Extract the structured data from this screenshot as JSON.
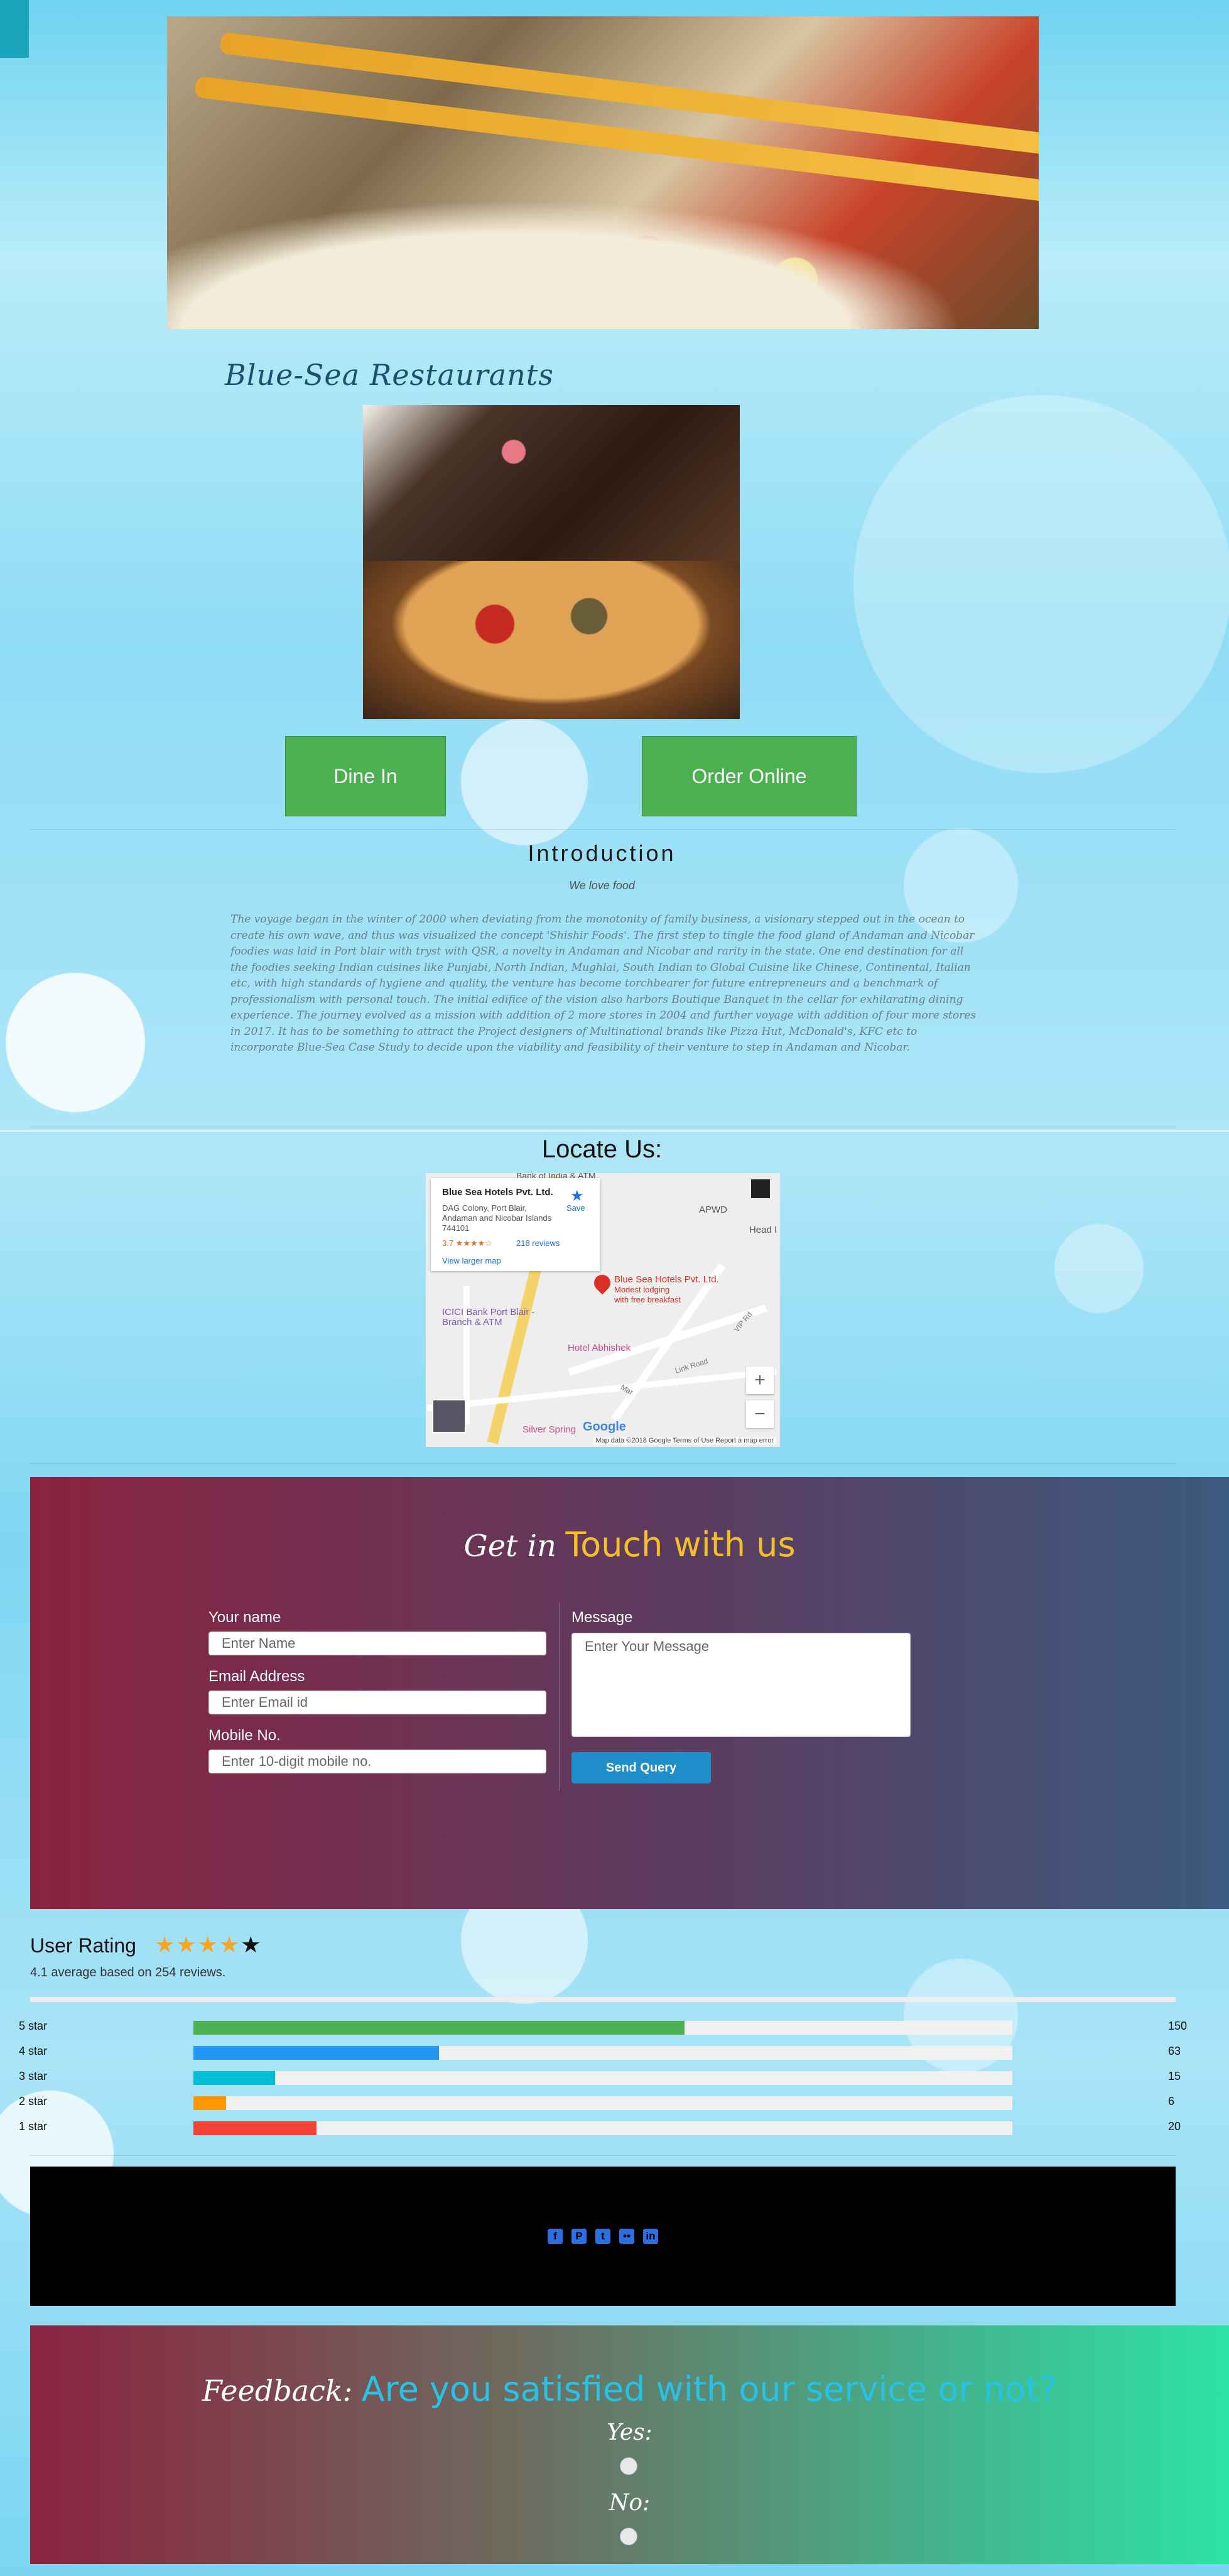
{
  "brand": "Blue-Sea Restaurants",
  "actions": {
    "dine_in": "Dine In",
    "order_online": "Order Online"
  },
  "intro": {
    "title": "Introduction",
    "subtitle": "We love food",
    "text": "The voyage began in the winter of 2000 when deviating from the monotonity of family business, a visionary stepped out in the ocean to create his own wave, and thus was visualized the concept 'Shishir Foods'. The first step to tingle the food gland of Andaman and Nicobar foodies was laid in Port blair with tryst with QSR, a novelty in Andaman and Nicobar and rarity in the state. One end destination for all the foodies seeking Indian cuisines like Punjabi, North Indian, Mughlai, South Indian to Global Cuisine like Chinese, Continental, Italian etc, with high standards of hygiene and quality, the venture has become torchbearer for future entrepreneurs and a benchmark of professionalism with personal touch. The initial edifice of the vision also harbors Boutique Banquet in the cellar for exhilarating dining experience. The journey evolved as a mission with addition of 2 more stores in 2004 and further voyage with addition of four more stores in 2017. It has to be something to attract the Project designers of Multinational brands like Pizza Hut, McDonald's, KFC etc to incorporate Blue-Sea Case Study to decide upon the viability and feasibility of their venture to step in Andaman and Nicobar."
  },
  "locate": {
    "title": "Locate Us:",
    "map": {
      "place_name": "Blue Sea Hotels Pvt. Ltd.",
      "address": "DAG Colony, Port Blair, Andaman and Nicobar Islands 744101",
      "rating": "3.7 ★★★★☆",
      "reviews": "218 reviews",
      "save": "Save",
      "view_larger": "View larger map",
      "pin_label": "Blue Sea Hotels Pvt. Ltd.",
      "pin_sub1": "Modest lodging",
      "pin_sub2": "with free breakfast",
      "poi_top": "Bank of India & ATM",
      "poi_apwd": "APWD",
      "poi_head": "Head I",
      "poi_icici": "ICICI Bank Port Blair - Branch & ATM",
      "poi_hotel": "Hotel Abhishek",
      "poi_silver": "Silver Spring",
      "poi_mar": "Mar",
      "road1": "Link Road",
      "road2": "VIP Rd",
      "zoom_in": "+",
      "zoom_out": "−",
      "google": "Google",
      "footer": "Map data ©2018 Google   Terms of Use   Report a map error"
    }
  },
  "contact": {
    "heading_a": "Get in",
    "heading_b": "Touch with us",
    "name_label": "Your name",
    "name_placeholder": "Enter Name",
    "email_label": "Email Address",
    "email_placeholder": "Enter Email id",
    "mobile_label": "Mobile No.",
    "mobile_placeholder": "Enter 10-digit mobile no.",
    "message_label": "Message",
    "message_placeholder": "Enter Your Message",
    "send": "Send Query"
  },
  "rating": {
    "title": "User Rating",
    "stars_filled": 4,
    "stars_total": 5,
    "summary": "4.1 average based on 254 reviews.",
    "rows": [
      {
        "label": "5 star",
        "count": "150",
        "fraction": 0.6,
        "color": "#4caf50"
      },
      {
        "label": "4 star",
        "count": "63",
        "fraction": 0.3,
        "color": "#2196f3"
      },
      {
        "label": "3 star",
        "count": "15",
        "fraction": 0.1,
        "color": "#00bcd4"
      },
      {
        "label": "2 star",
        "count": "6",
        "fraction": 0.04,
        "color": "#ff9800"
      },
      {
        "label": "1 star",
        "count": "20",
        "fraction": 0.15,
        "color": "#f44336"
      }
    ]
  },
  "social": [
    {
      "icon": "facebook-icon",
      "glyph": "f"
    },
    {
      "icon": "pinterest-icon",
      "glyph": "P"
    },
    {
      "icon": "twitter-icon",
      "glyph": "t"
    },
    {
      "icon": "flickr-icon",
      "glyph": "••"
    },
    {
      "icon": "linkedin-icon",
      "glyph": "in"
    }
  ],
  "feedback": {
    "heading_a": "Feedback:",
    "heading_b": "Are you satisfied with our service or not?",
    "yes": "Yes:",
    "no": "No:"
  },
  "colors": {
    "accent_green": "#4caf50",
    "send_blue": "#1e8fca",
    "touch_yellow": "#f4c025",
    "feedback_cyan": "#26c3e6"
  }
}
